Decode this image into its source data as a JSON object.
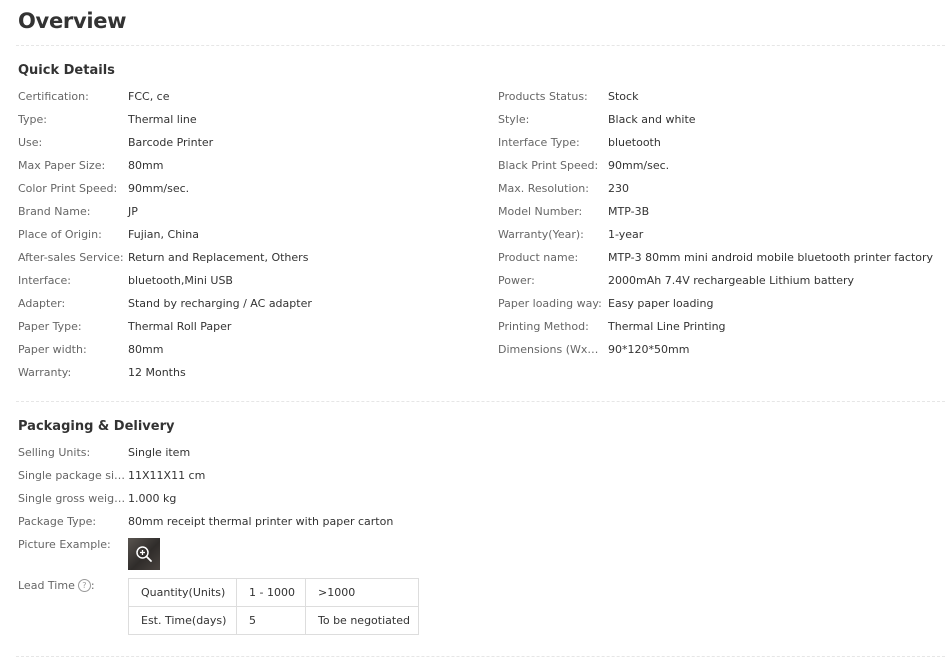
{
  "title": "Overview",
  "quick_details": {
    "heading": "Quick Details",
    "left": [
      {
        "label": "Certification:",
        "value": "FCC, ce"
      },
      {
        "label": "Type:",
        "value": "Thermal line"
      },
      {
        "label": "Use:",
        "value": "Barcode Printer"
      },
      {
        "label": "Max Paper Size:",
        "value": "80mm"
      },
      {
        "label": "Color Print Speed:",
        "value": "90mm/sec."
      },
      {
        "label": "Brand Name:",
        "value": "JP"
      },
      {
        "label": "Place of Origin:",
        "value": "Fujian, China"
      },
      {
        "label": "After-sales Service:",
        "value": "Return and Replacement, Others"
      },
      {
        "label": "Interface:",
        "value": "bluetooth,Mini USB"
      },
      {
        "label": "Adapter:",
        "value": "Stand by recharging / AC adapter"
      },
      {
        "label": "Paper Type:",
        "value": "Thermal Roll Paper"
      },
      {
        "label": "Paper width:",
        "value": "80mm"
      },
      {
        "label": "Warranty:",
        "value": "12 Months"
      }
    ],
    "right": [
      {
        "label": "Products Status:",
        "value": "Stock"
      },
      {
        "label": "Style:",
        "value": "Black and white"
      },
      {
        "label": "Interface Type:",
        "value": "bluetooth"
      },
      {
        "label": "Black Print Speed:",
        "value": "90mm/sec."
      },
      {
        "label": "Max. Resolution:",
        "value": "230"
      },
      {
        "label": "Model Number:",
        "value": "MTP-3B"
      },
      {
        "label": "Warranty(Year):",
        "value": "1-year"
      },
      {
        "label": "Product name:",
        "value": "MTP-3 80mm mini android mobile bluetooth printer factory"
      },
      {
        "label": "Power:",
        "value": "2000mAh 7.4V rechargeable Lithium battery"
      },
      {
        "label": "Paper loading way:",
        "value": "Easy paper loading"
      },
      {
        "label": "Printing Method:",
        "value": "Thermal Line Printing"
      },
      {
        "label": "Dimensions (WxDx...",
        "value": "90*120*50mm"
      }
    ]
  },
  "packaging": {
    "heading": "Packaging & Delivery",
    "rows": [
      {
        "label": "Selling Units:",
        "value": "Single item"
      },
      {
        "label": "Single package size:",
        "value": "11X11X11 cm"
      },
      {
        "label": "Single gross weight:",
        "value": "1.000 kg"
      },
      {
        "label": "Package Type:",
        "value": "80mm receipt thermal printer with paper carton"
      }
    ],
    "picture_label": "Picture Example:",
    "picture_icon": "zoom-icon",
    "lead_time": {
      "label": "Lead Time",
      "help_icon": "help-icon",
      "help_glyph": "?",
      "table": [
        [
          "Quantity(Units)",
          "1 - 1000",
          ">1000"
        ],
        [
          "Est. Time(days)",
          "5",
          "To be negotiated"
        ]
      ]
    }
  }
}
